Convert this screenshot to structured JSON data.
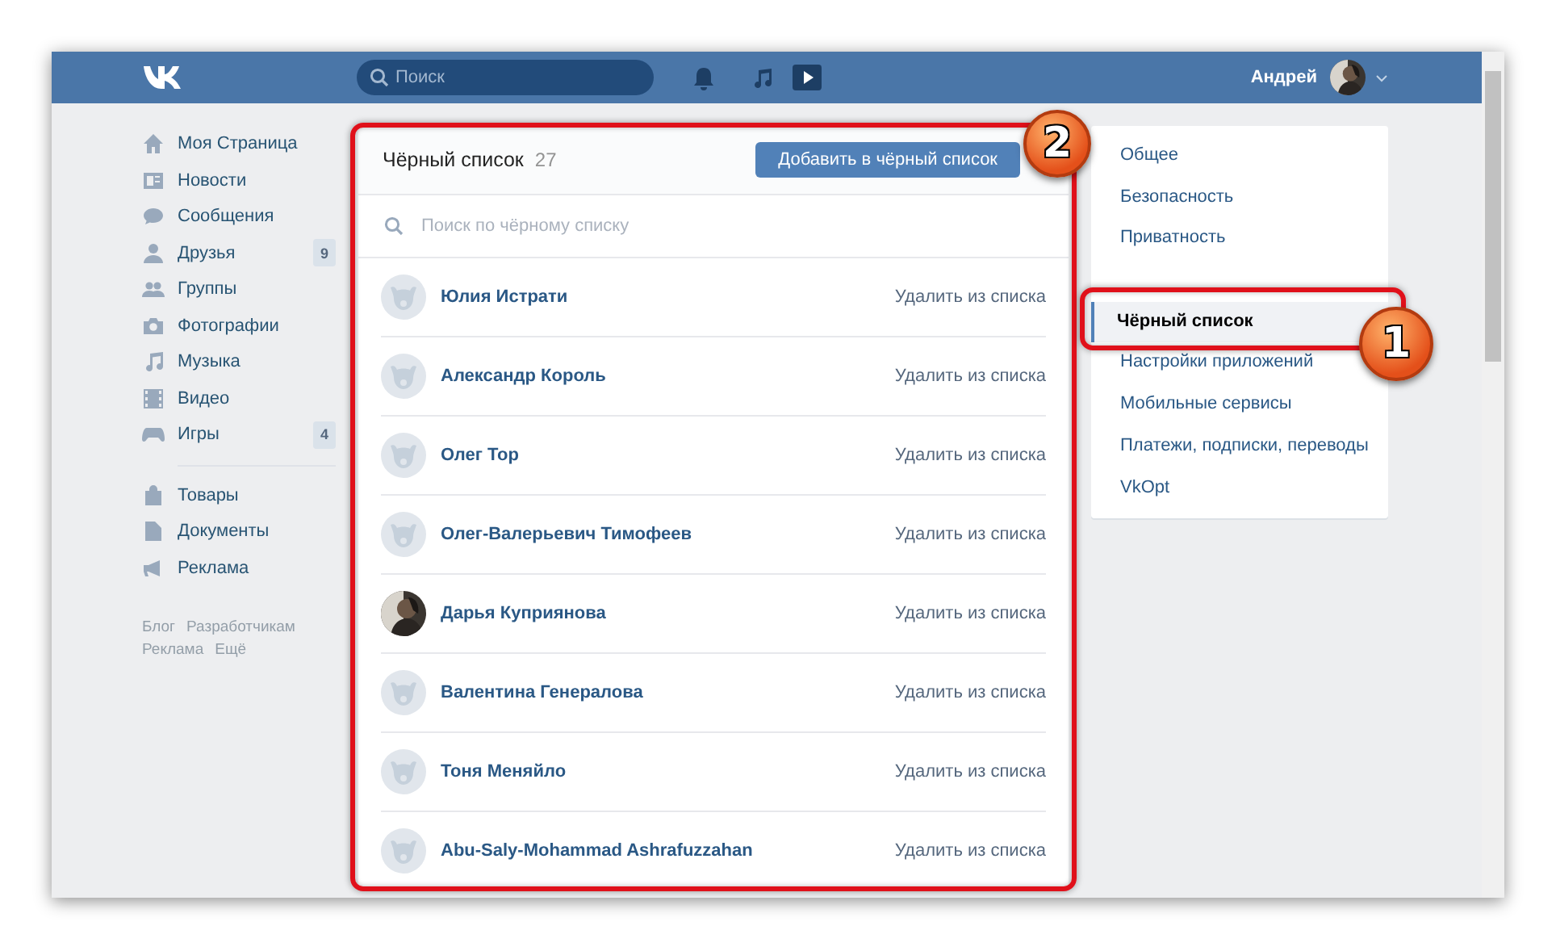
{
  "header": {
    "search": {
      "placeholder": "Поиск"
    },
    "user_name": "Андрей"
  },
  "sidebar": {
    "items": [
      {
        "label": "Моя Страница"
      },
      {
        "label": "Новости"
      },
      {
        "label": "Сообщения"
      },
      {
        "label": "Друзья",
        "count": "9"
      },
      {
        "label": "Группы"
      },
      {
        "label": "Фотографии"
      },
      {
        "label": "Музыка"
      },
      {
        "label": "Видео"
      },
      {
        "label": "Игры",
        "count": "4"
      }
    ],
    "items_2": [
      {
        "label": "Товары"
      },
      {
        "label": "Документы"
      },
      {
        "label": "Реклама"
      }
    ],
    "footer_links": [
      "Блог",
      "Разработчикам",
      "Реклама",
      "Ещё"
    ]
  },
  "blacklist": {
    "title": "Чёрный список",
    "count": "27",
    "add_button": "Добавить в чёрный список",
    "search": {
      "placeholder": "Поиск по чёрному списку"
    },
    "rows": [
      {
        "name": "Юлия Истрати",
        "kind": "default",
        "action": "Удалить из списка"
      },
      {
        "name": "Александр Король",
        "kind": "default",
        "action": "Удалить из списка"
      },
      {
        "name": "Олег Тор",
        "kind": "default",
        "action": "Удалить из списка"
      },
      {
        "name": "Олег-Валерьевич Тимофеев",
        "kind": "default",
        "action": "Удалить из списка"
      },
      {
        "name": "Дарья Куприянова",
        "kind": "picture",
        "action": "Удалить из списка"
      },
      {
        "name": "Валентина Генералова",
        "kind": "default",
        "action": "Удалить из списка"
      },
      {
        "name": "Тоня Меняйло",
        "kind": "default",
        "action": "Удалить из списка"
      },
      {
        "name": "Abu-Saly-Mohammad Ashrafuzzahan",
        "kind": "default",
        "action": "Удалить из списка"
      }
    ]
  },
  "settings_menu": {
    "items": [
      {
        "label": "Общее",
        "selected": false
      },
      {
        "label": "Безопасность",
        "selected": false
      },
      {
        "label": "Приватность",
        "selected": false
      },
      {
        "label": "Чёрный список",
        "selected": true
      },
      {
        "label": "Настройки приложений",
        "selected": false
      },
      {
        "label": "Мобильные сервисы",
        "selected": false
      },
      {
        "label": "Платежи, подписки, переводы",
        "selected": false
      },
      {
        "label": "VkOpt",
        "selected": false
      }
    ]
  },
  "annotations": [
    {
      "number": "2"
    },
    {
      "number": "1"
    }
  ]
}
